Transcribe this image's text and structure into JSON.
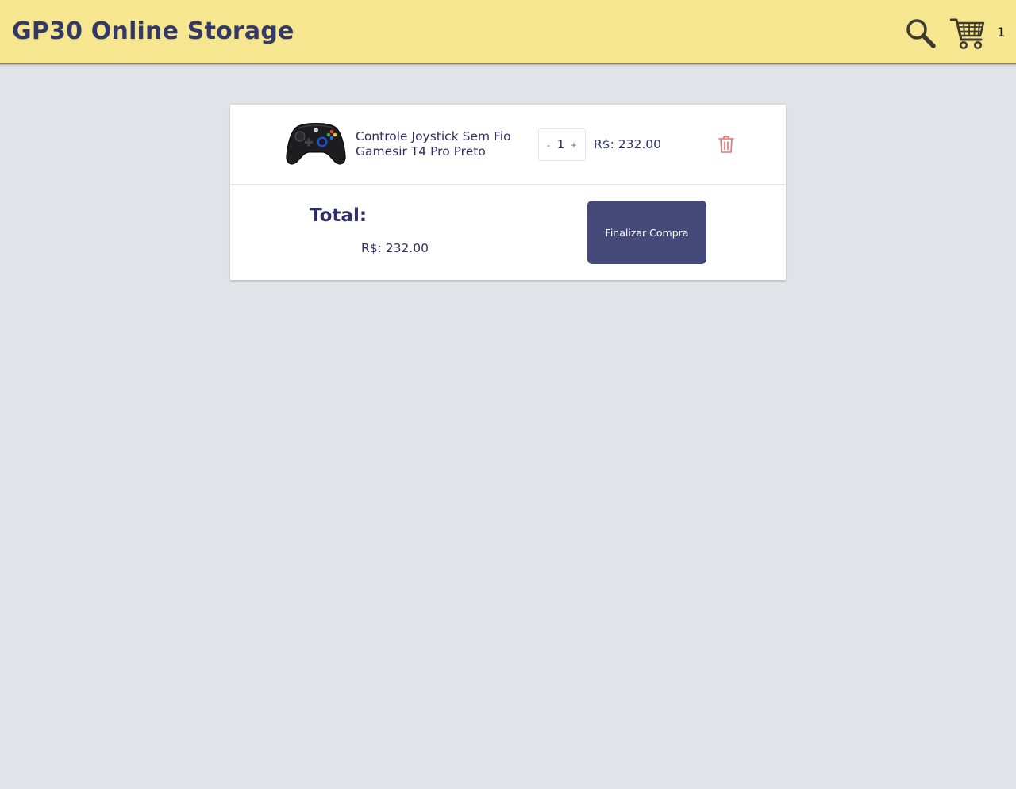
{
  "header": {
    "brand": "GP30 Online Storage",
    "search_icon": "search-icon",
    "cart_icon": "shopping-cart-icon",
    "cart_count": "1"
  },
  "cart": {
    "items": [
      {
        "name": "Controle Joystick Sem Fio Gamesir T4 Pro Preto",
        "image_icon": "gamepad-icon",
        "quantity": "1",
        "decrement_label": "-",
        "increment_label": "+",
        "price": "R$: 232.00",
        "delete_icon": "trash-icon"
      }
    ],
    "total_label": "Total:",
    "total_value": "R$: 232.00",
    "checkout_label": "Finalizar Compra"
  },
  "colors": {
    "header_bg": "#f7e690",
    "page_bg": "#e1e3e8",
    "brand_text": "#343866",
    "primary_button": "#45497a",
    "delete_icon": "#e8706f"
  }
}
